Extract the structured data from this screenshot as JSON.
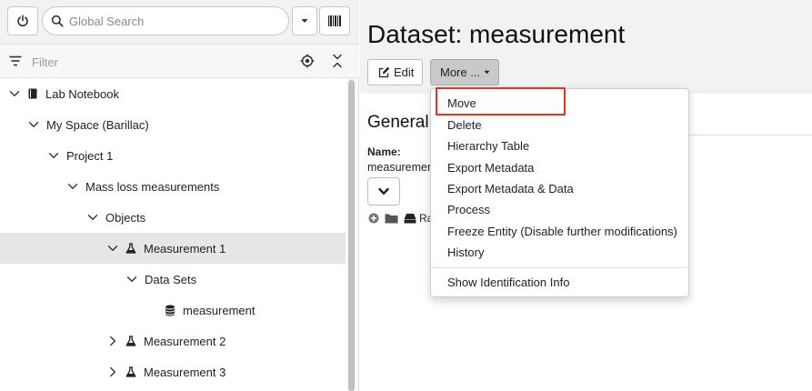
{
  "toolbar": {
    "search": {
      "placeholder": "Global Search",
      "value": ""
    },
    "power_icon": "power-icon",
    "dropdown_icon": "caret-down-icon",
    "barcode_icon": "barcode-icon"
  },
  "filter": {
    "placeholder": "Filter",
    "value": ""
  },
  "tree": [
    {
      "label": "Lab Notebook",
      "icon": "notebook-icon",
      "expanded": true
    },
    {
      "label": "My Space (Barillac)",
      "expanded": true
    },
    {
      "label": "Project 1",
      "expanded": true
    },
    {
      "label": "Mass loss measurements",
      "expanded": true
    },
    {
      "label": "Objects",
      "expanded": true
    },
    {
      "label": "Measurement 1",
      "icon": "flask-icon",
      "expanded": true,
      "selected": true
    },
    {
      "label": "Data Sets",
      "expanded": true
    },
    {
      "label": "measurement",
      "icon": "database-icon"
    },
    {
      "label": "Measurement 2",
      "icon": "flask-icon",
      "expanded": false
    },
    {
      "label": "Measurement 3",
      "icon": "flask-icon",
      "expanded": false
    }
  ],
  "main": {
    "title": "Dataset: measurement",
    "edit_label": "Edit",
    "more_label": "More ...",
    "section_title": "General",
    "name_label": "Name:",
    "name_value": "measurement",
    "truncated_text": "Ra"
  },
  "menu": {
    "items": [
      "Move",
      "Delete",
      "Hierarchy Table",
      "Export Metadata",
      "Export Metadata & Data",
      "Process",
      "Freeze Entity (Disable further modifications)",
      "History"
    ],
    "footer_item": "Show Identification Info",
    "highlighted_item": "Move"
  },
  "colors": {
    "highlight": "#e8321e",
    "header_bg": "#f2f2f2",
    "selected_row": "#e6e6e6",
    "more_button": "#c9c9c9"
  }
}
